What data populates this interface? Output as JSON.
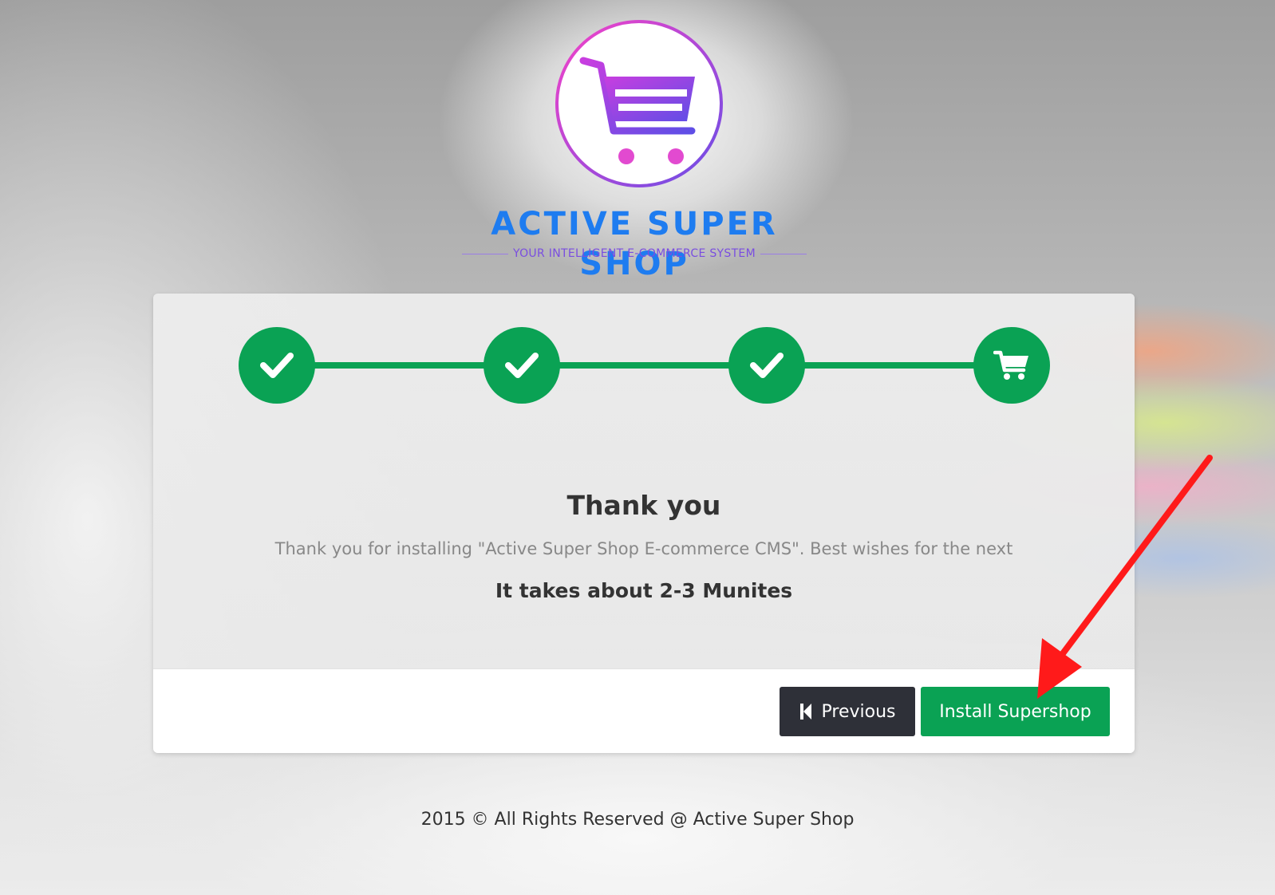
{
  "brand": {
    "title": "ACTIVE SUPER SHOP",
    "tagline": "YOUR INTELLIGENT E-COMMERCE SYSTEM",
    "logo_icon": "shopping-cart-icon",
    "colors": {
      "title": "#1e7cf0",
      "tagline": "#7a4ee0",
      "logo_gradient_start": "#f542c8",
      "logo_gradient_end": "#6a4ee6"
    }
  },
  "wizard": {
    "steps": [
      {
        "status": "complete",
        "icon": "check-icon"
      },
      {
        "status": "complete",
        "icon": "check-icon"
      },
      {
        "status": "complete",
        "icon": "check-icon"
      },
      {
        "status": "current",
        "icon": "shopping-cart-icon"
      }
    ],
    "accent_color": "#0aa254"
  },
  "content": {
    "title": "Thank you",
    "message": "Thank you for installing \"Active Super Shop E-commerce CMS\". Best wishes for the next",
    "time_note": "It takes about 2-3 Munites"
  },
  "buttons": {
    "previous": {
      "label": "Previous",
      "icon": "skip-back-icon",
      "color": "#2e3038"
    },
    "install": {
      "label": "Install Supershop",
      "color": "#0aa254"
    }
  },
  "footer": {
    "text": "2015 © All Rights Reserved @ Active Super Shop"
  },
  "annotation": {
    "type": "arrow",
    "color": "#ff1a1a",
    "target": "install-supershop-button"
  }
}
